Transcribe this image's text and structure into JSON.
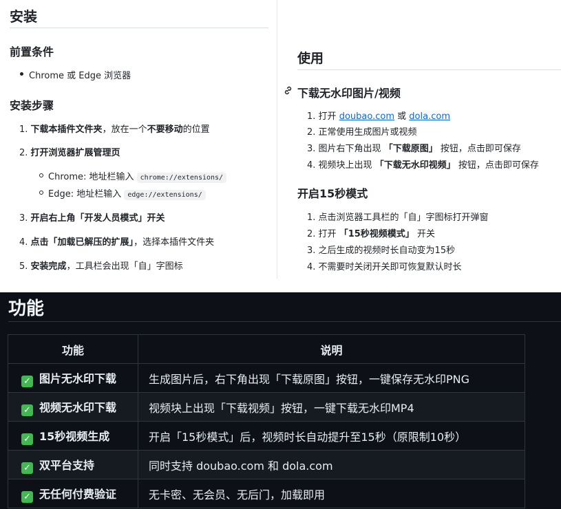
{
  "left": {
    "install_title": "安装",
    "prereq_title": "前置条件",
    "prereq_item": "Chrome 或 Edge 浏览器",
    "steps_title": "安装步骤",
    "steps": [
      {
        "num": "1.",
        "bold": "下载本插件文件夹",
        "text1": "，放在一个",
        "bold2": "不要移动",
        "text2": "的位置"
      },
      {
        "num": "2.",
        "bold": "打开浏览器扩展管理页"
      },
      {
        "num": "3.",
        "bold": "开启右上角「开发人员模式」开关"
      },
      {
        "num": "4.",
        "bold": "点击「加载已解压的扩展」",
        "text1": "，选择本插件文件夹"
      },
      {
        "num": "5.",
        "bold": "安装完成",
        "text1": "，工具栏会出现「自」字图标"
      }
    ],
    "sub": [
      {
        "label": "Chrome: 地址栏输入",
        "code": "chrome://extensions/"
      },
      {
        "label": "Edge: 地址栏输入",
        "code": "edge://extensions/"
      }
    ]
  },
  "right": {
    "usage_title": "使用",
    "download_title": "下载无水印图片/视频",
    "download_steps": {
      "s1_num": "1.",
      "s1_pre": "打开",
      "s1_link1": "doubao.com",
      "s1_or": "或",
      "s1_link2": "dola.com",
      "s2_num": "2.",
      "s2": "正常使用生成图片或视频",
      "s3_num": "3.",
      "s3_pre": "图片右下角出现",
      "s3_bold": "「下载原图」",
      "s3_post": "按钮，点击即可保存",
      "s4_num": "4.",
      "s4_pre": "视频块上出现",
      "s4_bold": "「下载无水印视频」",
      "s4_post": "按钮，点击即可保存"
    },
    "mode_title": "开启15秒模式",
    "mode_steps": {
      "m1_num": "1.",
      "m1": "点击浏览器工具栏的「自」字图标打开弹窗",
      "m2_num": "2.",
      "m2_pre": "打开",
      "m2_bold": "「15秒视频模式」",
      "m2_post": "开关",
      "m3_num": "3.",
      "m3": "之后生成的视频时长自动变为15秒",
      "m4_num": "4.",
      "m4": "不需要时关闭开关即可恢复默认时长"
    }
  },
  "features": {
    "title": "功能",
    "header": [
      "功能",
      "说明"
    ],
    "check_glyph": "✓",
    "rows": [
      {
        "name": "图片无水印下载",
        "desc": "生成图片后，右下角出现「下载原图」按钮，一键保存无水印PNG"
      },
      {
        "name": "视频无水印下载",
        "desc": "视频块上出现「下载视频」按钮，一键下载无水印MP4"
      },
      {
        "name": "15秒视频生成",
        "desc": "开启「15秒模式」后，视频时长自动提升至15秒（原限制10秒）"
      },
      {
        "name": "双平台支持",
        "desc": "同时支持 doubao.com 和 dola.com"
      },
      {
        "name": "无任何付费验证",
        "desc": "无卡密、无会员、无后门，加载即用"
      }
    ]
  },
  "colors": {
    "link": "#0969da",
    "dark_bg": "#0d1117",
    "check": "#3fb950"
  }
}
